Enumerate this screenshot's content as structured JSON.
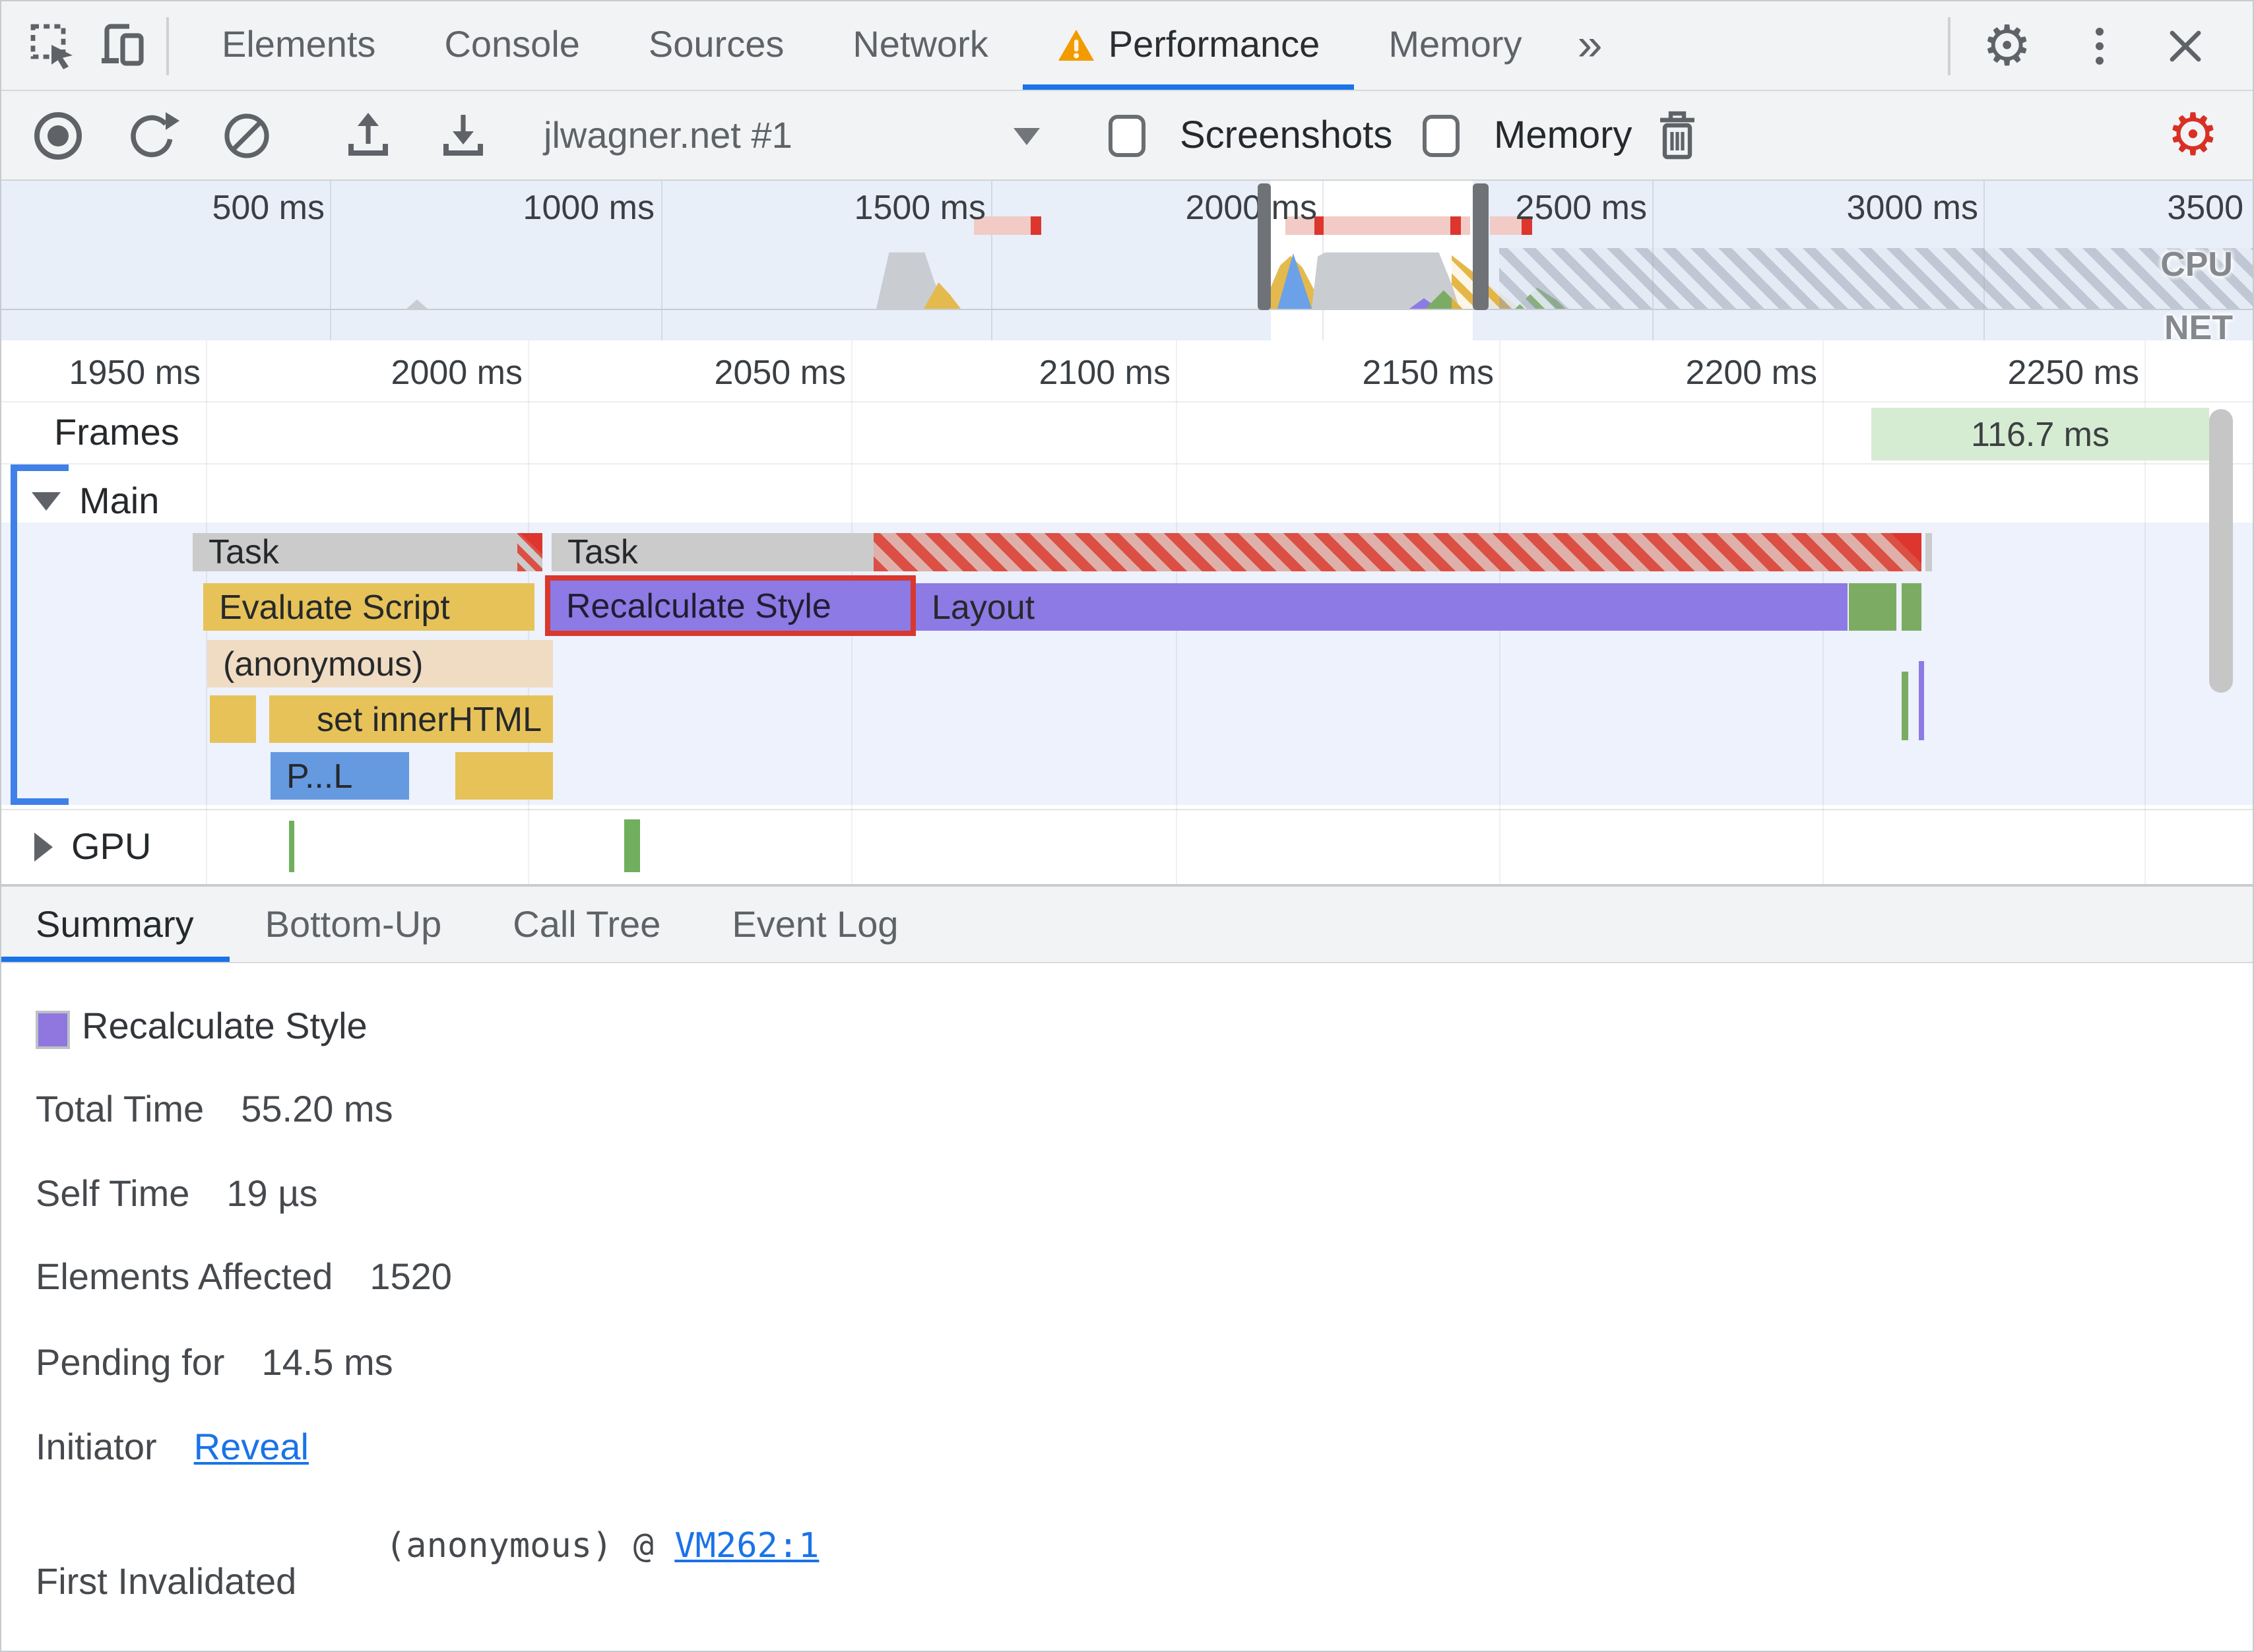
{
  "top_tabbar": {
    "tabs": [
      "Elements",
      "Console",
      "Sources",
      "Network",
      "Performance",
      "Memory"
    ],
    "overflow_icon": "»"
  },
  "toolbar": {
    "session_label": "jlwagner.net #1",
    "screenshots_label": "Screenshots",
    "memory_label": "Memory"
  },
  "overview": {
    "ticks": [
      "500 ms",
      "1000 ms",
      "1500 ms",
      "2000 ms",
      "2500 ms",
      "3000 ms",
      "3500"
    ],
    "cpu_label": "CPU",
    "net_label": "NET"
  },
  "flame": {
    "ruler_ticks": [
      "1950 ms",
      "2000 ms",
      "2050 ms",
      "2100 ms",
      "2150 ms",
      "2200 ms",
      "2250 ms"
    ],
    "frames_label": "Frames",
    "frame_duration": "116.7 ms",
    "main_label": "Main",
    "gpu_label": "GPU",
    "bars": {
      "task1": "Task",
      "task2": "Task",
      "evaluate_script": "Evaluate Script",
      "recalculate_style": "Recalculate Style",
      "layout": "Layout",
      "anonymous": "(anonymous)",
      "set_inner_html": "set innerHTML",
      "parse_html": "P...L"
    }
  },
  "bottom_tabs": {
    "summary": "Summary",
    "bottom_up": "Bottom-Up",
    "call_tree": "Call Tree",
    "event_log": "Event Log"
  },
  "summary": {
    "title": "Recalculate Style",
    "total_time_label": "Total Time",
    "total_time": "55.20 ms",
    "self_time_label": "Self Time",
    "self_time": "19 µs",
    "elements_label": "Elements Affected",
    "elements": "1520",
    "pending_label": "Pending for",
    "pending": "14.5 ms",
    "initiator_label": "Initiator",
    "initiator_link": "Reveal",
    "first_invalidated_label": "First Invalidated",
    "stack_prefix": "(anonymous) @",
    "stack_link": "VM262:1"
  },
  "colors": {
    "accent_blue": "#1a73e8",
    "selection_red": "#d8382e",
    "purple_style": "#8d7ae4",
    "scripting_yellow": "#e6c258",
    "task_gray": "#cbcbcb",
    "rendering_green": "#7cac63",
    "frame_green": "#d6ecd2",
    "warning_amber": "#f29b00"
  }
}
